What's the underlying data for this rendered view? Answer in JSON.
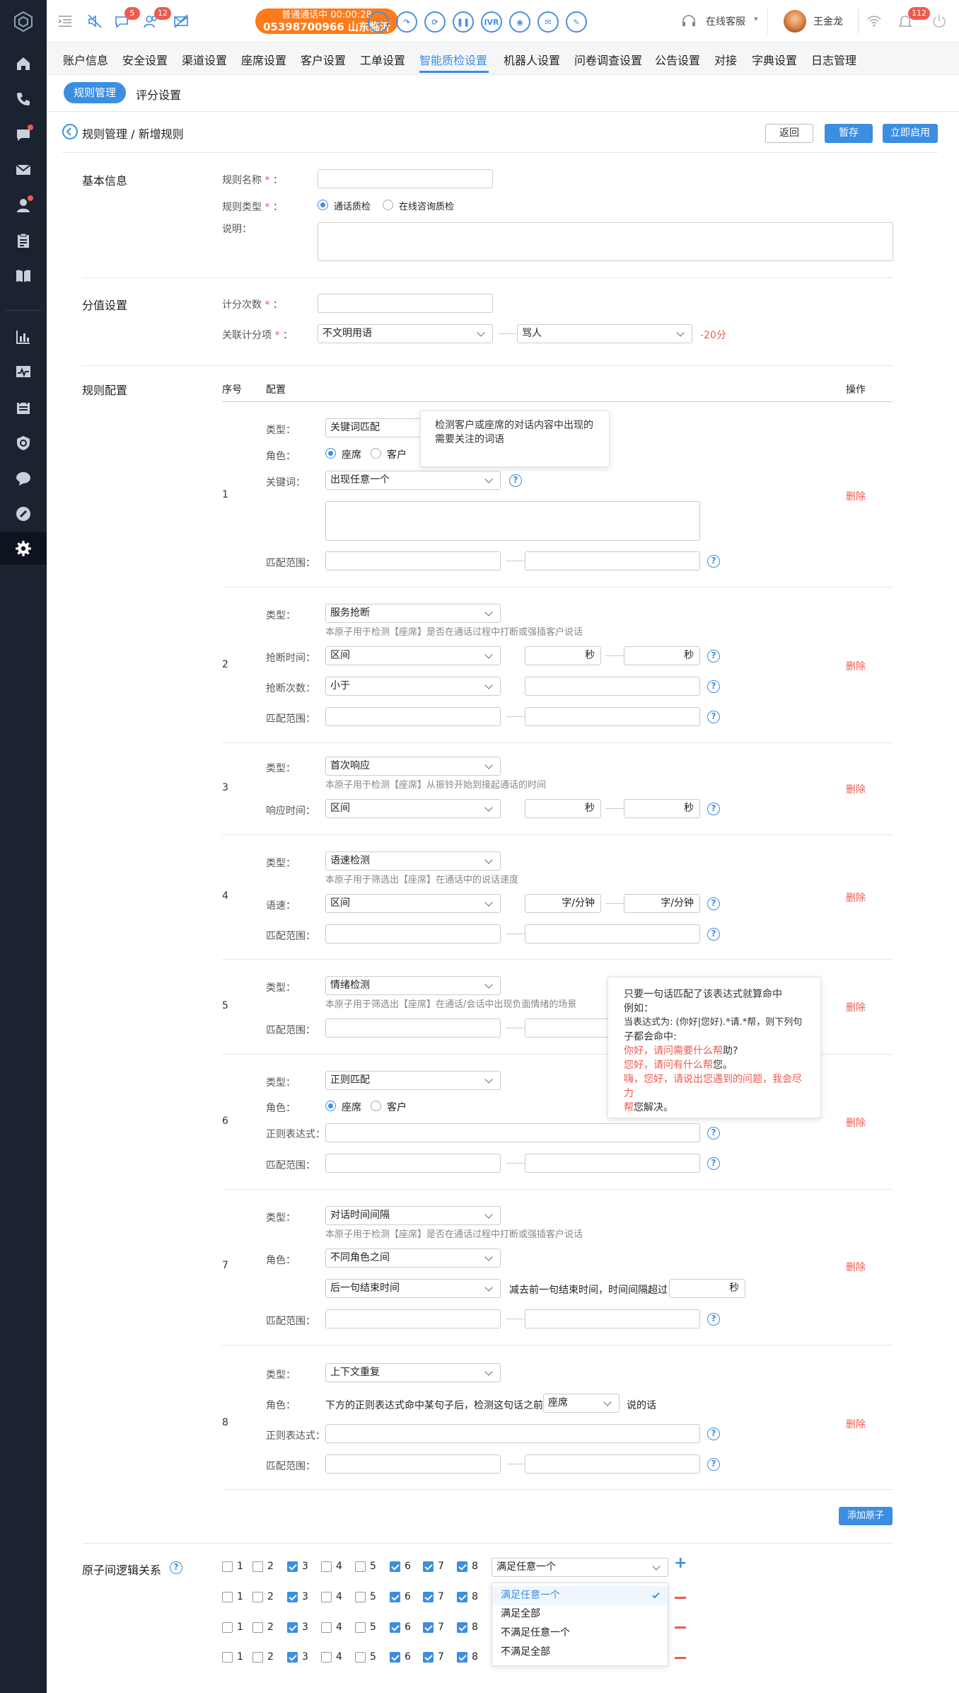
{
  "topbar": {
    "call_status": "普通通话中  00:00:28",
    "call_number": "05398700966 山东临沂",
    "badge_chat": "5",
    "badge_users": "12",
    "ivr": "IVR",
    "online_service": "在线客服",
    "username": "王金龙",
    "badge_notify": "112"
  },
  "menu": [
    "账户信息",
    "安全设置",
    "渠道设置",
    "座席设置",
    "客户设置",
    "工单设置",
    "智能质检设置",
    "机器人设置",
    "问卷调查设置",
    "公告设置",
    "对接",
    "字典设置",
    "日志管理"
  ],
  "subtabs": {
    "active": "规则管理",
    "other": "评分设置"
  },
  "header": {
    "title": "规则管理 / 新增规则",
    "back": "返回",
    "save": "暂存",
    "enable": "立即启用"
  },
  "basic": {
    "section": "基本信息",
    "name_label": "规则名称",
    "type_label": "规则类型",
    "opt1": "通话质检",
    "opt2": "在线咨询质检",
    "desc_label": "说明："
  },
  "score": {
    "section": "分值设置",
    "count_label": "计分次数",
    "item_label": "关联计分项",
    "sel1": "不文明用语",
    "sel2": "骂人",
    "points": "-20分"
  },
  "config": {
    "section": "规则配置",
    "col_no": "序号",
    "col_cfg": "配置",
    "col_op": "操作",
    "delete": "删除",
    "add": "添加原子"
  },
  "labels": {
    "type": "类型：",
    "role": "角色：",
    "keyword": "关键词：",
    "range": "匹配范围：",
    "interrupt_time": "抢断时间：",
    "interrupt_count": "抢断次数：",
    "resp_time": "响应时间：",
    "speed": "语速：",
    "regex": "正则表达式：",
    "seat": "座席",
    "customer": "客户",
    "sec": "秒",
    "wpm": "字/分钟"
  },
  "atoms": [
    {
      "no": "1",
      "type": "关键词匹配",
      "kw_sel": "出现任意一个"
    },
    {
      "no": "2",
      "type": "服务抢断",
      "hint": "本原子用于检测【座席】是否在通话过程中打断或强插客户说话",
      "time_sel": "区间",
      "count_sel": "小于"
    },
    {
      "no": "3",
      "type": "首次响应",
      "hint": "本原子用于检测【座席】从振铃开始到接起通话的时间",
      "time_sel": "区间"
    },
    {
      "no": "4",
      "type": "语速检测",
      "hint": "本原子用于筛选出【座席】在通话中的说话速度",
      "speed_sel": "区间"
    },
    {
      "no": "5",
      "type": "情绪检测",
      "hint": "本原子用于筛选出【座席】在通话/会话中出现负面情绪的场景"
    },
    {
      "no": "6",
      "type": "正则匹配"
    },
    {
      "no": "7",
      "type": "对话时间间隔",
      "hint": "本原子用于检测【座席】是否在通话过程中打断或强插客户说话",
      "role_sel": "不同角色之间",
      "end_sel": "后一句结束时间",
      "mid": "减去前一句结束时间，时间间隔超过"
    },
    {
      "no": "8",
      "type": "上下文重复",
      "role_pre": "下方的正则表达式命中某句子后，检测这句话之前",
      "role_sel": "座席",
      "role_post": "说的话"
    }
  ],
  "tip1": {
    "l1": "检测客户或座席的对话内容中出现的",
    "l2": "需要关注的词语"
  },
  "tip2": {
    "l1": "只要一句话匹配了该表达式就算命中",
    "l2": "例如：",
    "l3": "当表达式为: (你好|您好).*请.*帮，则下列句",
    "l4": "子都会命中:",
    "e1a": "你好，请问需要什么帮",
    "e1b": "助?",
    "e2a": "您好，请问有什么帮",
    "e2b": "您。",
    "e3a": "嗨，您好，请说出您遇到的问题，我会尽力",
    "e3b": "帮",
    "e3c": "您解决。"
  },
  "logic": {
    "label": "原子间逻辑关系",
    "sel": "满足任意一个",
    "nums": [
      "1",
      "2",
      "3",
      "4",
      "5",
      "6",
      "7",
      "8"
    ],
    "checked": [
      3,
      6,
      7,
      8
    ],
    "options": [
      "满足任意一个",
      "满足全部",
      "不满足任意一个",
      "不满足全部"
    ]
  }
}
